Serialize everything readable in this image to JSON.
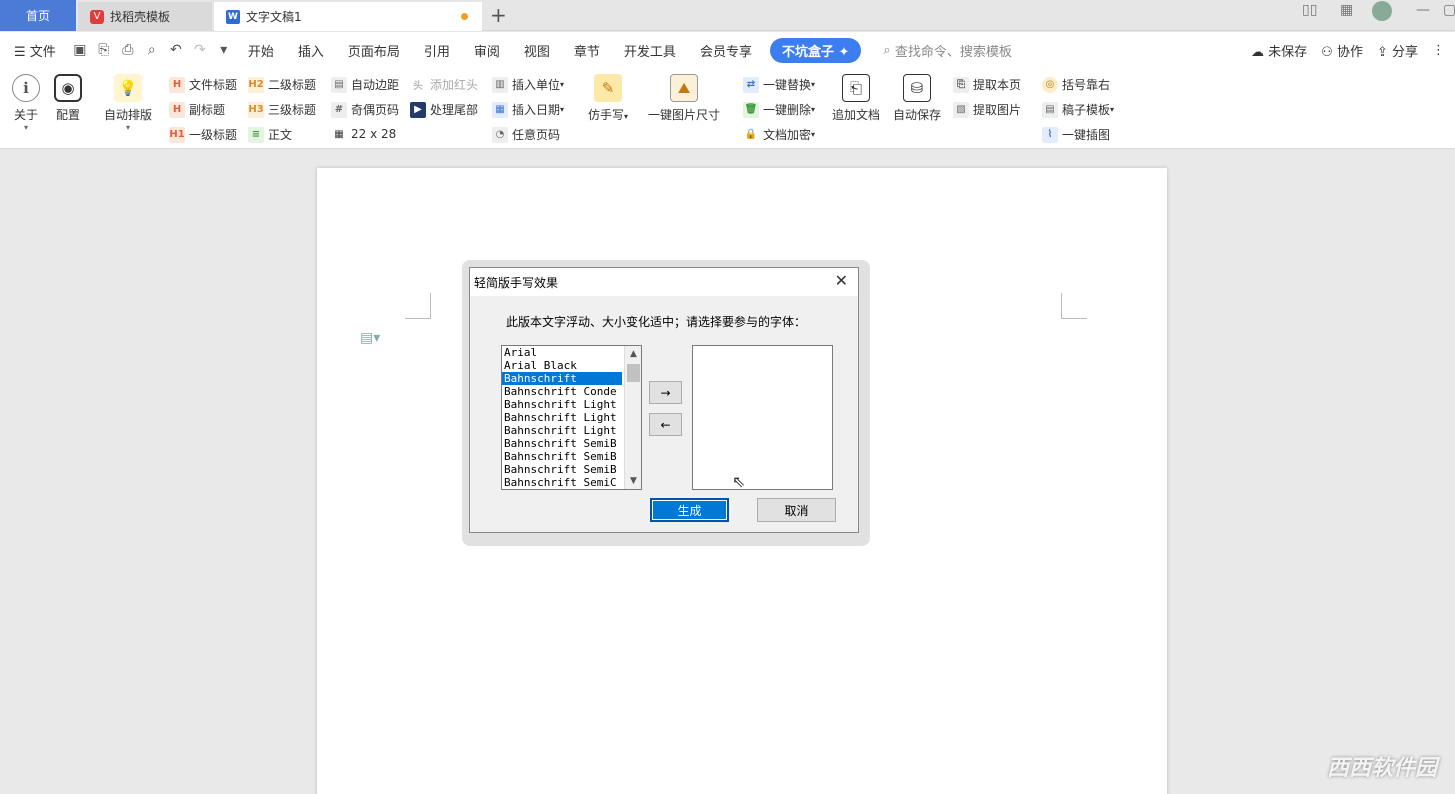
{
  "tabs": {
    "home": "首页",
    "template": "找稻壳模板",
    "document": "文字文稿1",
    "new_tab": "+"
  },
  "menubar": {
    "file": "文件",
    "items": [
      "开始",
      "插入",
      "页面布局",
      "引用",
      "审阅",
      "视图",
      "章节",
      "开发工具",
      "会员专享"
    ],
    "special": "不坑盒子",
    "search_placeholder": "查找命令、搜索模板",
    "unsaved": "未保存",
    "collab": "协作",
    "share": "分享"
  },
  "ribbon": {
    "about": "关于",
    "config": "配置",
    "auto_layout": "自动排版",
    "doc_title": "文件标题",
    "subtitle": "副标题",
    "h1": "一级标题",
    "h2": "二级标题",
    "h3": "三级标题",
    "body_text": "正文",
    "auto_margin": "自动边距",
    "odd_even_page": "奇偶页码",
    "grid_size": "22 x 28",
    "add_red_header": "添加红头",
    "process_tail": "处理尾部",
    "insert_unit": "插入单位",
    "insert_date": "插入日期",
    "any_page_num": "任意页码",
    "imitate_handwriting": "仿手写",
    "one_click_img_size": "一键图片尺寸",
    "one_click_replace": "一键替换",
    "one_click_delete": "一键删除",
    "doc_encrypt": "文档加密",
    "append_doc": "追加文档",
    "auto_save": "自动保存",
    "extract_page": "提取本页",
    "extract_image": "提取图片",
    "bracket_right": "括号靠右",
    "draft_template": "稿子模板",
    "one_click_illustration": "一键插图"
  },
  "dialog": {
    "title": "轻简版手写效果",
    "prompt": "此版本文字浮动、大小变化适中；请选择要参与的字体：",
    "fonts": [
      "Arial",
      "Arial Black",
      "Bahnschrift",
      "Bahnschrift Conde",
      "Bahnschrift Light",
      "Bahnschrift Light",
      "Bahnschrift Light",
      "Bahnschrift SemiB",
      "Bahnschrift SemiB",
      "Bahnschrift SemiB",
      "Bahnschrift SemiC"
    ],
    "selected_index": 2,
    "add_arrow": "→",
    "remove_arrow": "←",
    "generate": "生成",
    "cancel": "取消"
  },
  "watermark": "西西软件园",
  "colors": {
    "accent": "#4b7bd6",
    "special_tab": "#3c7df0",
    "selection": "#0078d7"
  }
}
